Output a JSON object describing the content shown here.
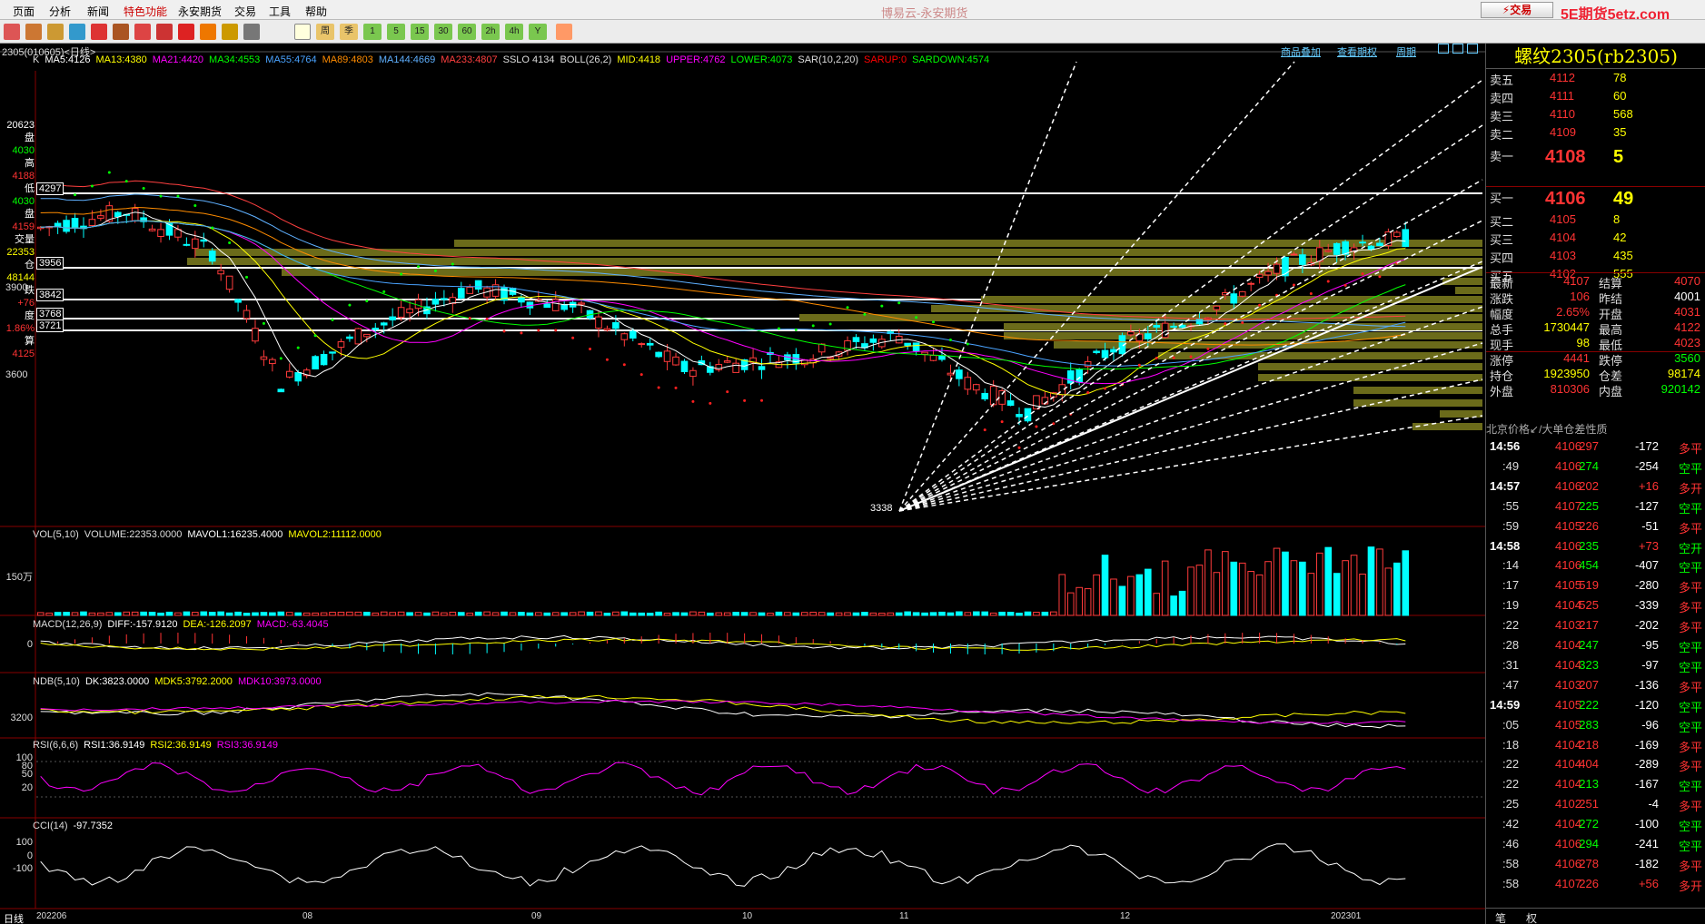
{
  "menu": [
    "页面",
    "分析",
    "新闻",
    "特色功能",
    "永安期货",
    "交易",
    "工具",
    "帮助"
  ],
  "app_title": "博易云-永安期货",
  "trade_button": "交易",
  "watermark": "5E期货5etz.com",
  "toolbar_labels": [
    "周",
    "季",
    "1",
    "5",
    "15",
    "30",
    "60",
    "2h",
    "4h",
    "Y"
  ],
  "chart_header": {
    "symbol": "2305(010605)<日线>",
    "links": [
      "商品叠加",
      "查看期权",
      "周期"
    ]
  },
  "ma_line": [
    {
      "text": "K",
      "color": "#dddddd"
    },
    {
      "text": "MA5:4126",
      "color": "#ffffff"
    },
    {
      "text": "MA13:4380",
      "color": "#ffff00"
    },
    {
      "text": "MA21:4420",
      "color": "#ff00ff"
    },
    {
      "text": "MA34:4553",
      "color": "#00ff00"
    },
    {
      "text": "MA55:4764",
      "color": "#4aa3ff"
    },
    {
      "text": "MA89:4803",
      "color": "#ff8c00"
    },
    {
      "text": "MA144:4669",
      "color": "#5fb0ff"
    },
    {
      "text": "MA233:4807",
      "color": "#ff4040"
    },
    {
      "text": "SSLO 4134",
      "color": "#dddddd"
    },
    {
      "text": "BOLL(26,2)",
      "color": "#dddddd"
    },
    {
      "text": "MID:4418",
      "color": "#ffff00"
    },
    {
      "text": "UPPER:4762",
      "color": "#ff00ff"
    },
    {
      "text": "LOWER:4073",
      "color": "#00ff00"
    },
    {
      "text": "SAR(10,2,20)",
      "color": "#dddddd"
    },
    {
      "text": "SARUP:0",
      "color": "#ff0000"
    },
    {
      "text": "SARDOWN:4574",
      "color": "#00ff00"
    }
  ],
  "left_info": [
    {
      "text": "20623",
      "color": "#ffffff"
    },
    {
      "text": "盘",
      "color": "#ffffff"
    },
    {
      "text": "4030",
      "color": "#00ff00"
    },
    {
      "text": "高",
      "color": "#ffffff"
    },
    {
      "text": "4188",
      "color": "#ff3333"
    },
    {
      "text": "低",
      "color": "#ffffff"
    },
    {
      "text": "4030",
      "color": "#00ff00"
    },
    {
      "text": "盘",
      "color": "#ffffff"
    },
    {
      "text": "4159",
      "color": "#ff3333"
    },
    {
      "text": "交量",
      "color": "#ffffff"
    },
    {
      "text": "22353",
      "color": "#ffff00"
    },
    {
      "text": "仓",
      "color": "#ffffff"
    },
    {
      "text": "48144",
      "color": "#ffff00"
    },
    {
      "text": "跌",
      "color": "#ffffff"
    },
    {
      "text": "+76",
      "color": "#ff3333"
    },
    {
      "text": "度",
      "color": "#ffffff"
    },
    {
      "text": "1.86%",
      "color": "#ff3333"
    },
    {
      "text": "算",
      "color": "#ffffff"
    },
    {
      "text": "4125",
      "color": "#ff3333"
    }
  ],
  "price_levels": [
    {
      "label": "4297"
    },
    {
      "label": "3956"
    },
    {
      "label": "3842"
    },
    {
      "label": "3768"
    },
    {
      "label": "3721"
    }
  ],
  "y_axis_labels": [
    "3900",
    "3600"
  ],
  "low_marker": "3338",
  "volume_pane": {
    "title": "VOL(5,10)",
    "items": [
      {
        "text": "VOLUME:22353.0000",
        "color": "#dddddd"
      },
      {
        "text": "MAVOL1:16235.4000",
        "color": "#ffffff"
      },
      {
        "text": "MAVOL2:11112.0000",
        "color": "#ffff00"
      }
    ],
    "axis": "150万"
  },
  "macd_pane": {
    "title": "MACD(12,26,9)",
    "items": [
      {
        "text": "DIFF:-157.9120",
        "color": "#ffffff"
      },
      {
        "text": "DEA:-126.2097",
        "color": "#ffff00"
      },
      {
        "text": "MACD:-63.4045",
        "color": "#ff00ff"
      }
    ],
    "axis": "0"
  },
  "ndb_pane": {
    "title": "NDB(5,10)",
    "items": [
      {
        "text": "DK:3823.0000",
        "color": "#ffffff"
      },
      {
        "text": "MDK5:3792.2000",
        "color": "#ffff00"
      },
      {
        "text": "MDK10:3973.0000",
        "color": "#ff00ff"
      }
    ],
    "axis": "3200"
  },
  "rsi_pane": {
    "title": "RSI(6,6,6)",
    "items": [
      {
        "text": "RSI1:36.9149",
        "color": "#ffffff"
      },
      {
        "text": "RSI2:36.9149",
        "color": "#ffff00"
      },
      {
        "text": "RSI3:36.9149",
        "color": "#ff00ff"
      }
    ],
    "axis": [
      "100",
      "50",
      "20"
    ],
    "axis_top": "80"
  },
  "cci_pane": {
    "title": "CCI(14)",
    "items": [
      {
        "text": "-97.7352",
        "color": "#ffffff"
      }
    ],
    "axis": [
      "100",
      "0",
      "-100"
    ]
  },
  "x_axis": {
    "period_label": "日线",
    "labels": [
      "202206",
      "08",
      "09",
      "10",
      "11",
      "12",
      "202301"
    ]
  },
  "right_panel": {
    "title": "螺纹2305(rb2305)",
    "asks": [
      {
        "label": "卖五",
        "price": "4112",
        "qty": "78"
      },
      {
        "label": "卖四",
        "price": "4111",
        "qty": "60"
      },
      {
        "label": "卖三",
        "price": "4110",
        "qty": "568"
      },
      {
        "label": "卖二",
        "price": "4109",
        "qty": "35"
      },
      {
        "label": "卖一",
        "price": "4108",
        "qty": "5"
      }
    ],
    "bids": [
      {
        "label": "买一",
        "price": "4106",
        "qty": "49"
      },
      {
        "label": "买二",
        "price": "4105",
        "qty": "8"
      },
      {
        "label": "买三",
        "price": "4104",
        "qty": "42"
      },
      {
        "label": "买四",
        "price": "4103",
        "qty": "435"
      },
      {
        "label": "买五",
        "price": "4102",
        "qty": "555"
      }
    ],
    "stats": [
      {
        "l1": "最新",
        "v1": "4107",
        "c1": "#ff3333",
        "l2": "结算",
        "v2": "4070",
        "c2": "#ff3333"
      },
      {
        "l1": "涨跌",
        "v1": "106",
        "c1": "#ff3333",
        "l2": "昨结",
        "v2": "4001",
        "c2": "#ffffff"
      },
      {
        "l1": "幅度",
        "v1": "2.65%",
        "c1": "#ff3333",
        "l2": "开盘",
        "v2": "4031",
        "c2": "#ff3333"
      },
      {
        "l1": "总手",
        "v1": "1730447",
        "c1": "#ffff00",
        "l2": "最高",
        "v2": "4122",
        "c2": "#ff3333"
      },
      {
        "l1": "现手",
        "v1": "98",
        "c1": "#ffff00",
        "l2": "最低",
        "v2": "4023",
        "c2": "#ff3333"
      },
      {
        "l1": "涨停",
        "v1": "4441",
        "c1": "#ff3333",
        "l2": "跌停",
        "v2": "3560",
        "c2": "#00ff00"
      },
      {
        "l1": "持仓",
        "v1": "1923950",
        "c1": "#ffff00",
        "l2": "仓差",
        "v2": "98174",
        "c2": "#ffff00"
      },
      {
        "l1": "外盘",
        "v1": "810306",
        "c1": "#ff3333",
        "l2": "内盘",
        "v2": "920142",
        "c2": "#00ff00"
      }
    ],
    "tick_header": {
      "time": "北京",
      "price": "价格",
      "vol": "↙/大单",
      "oi": "仓差",
      "type": "性质"
    },
    "ticks": [
      {
        "time": "14:56",
        "price": "4106",
        "vol": "297",
        "oi": "-172",
        "type": "多平",
        "major": true
      },
      {
        "time": ":49",
        "price": "4106",
        "vol": "274",
        "oi": "-254",
        "type": "空平",
        "major": false
      },
      {
        "time": "14:57",
        "price": "4106",
        "vol": "202",
        "oi": "+16",
        "type": "多开",
        "major": true
      },
      {
        "time": ":55",
        "price": "4107",
        "vol": "225",
        "oi": "-127",
        "type": "空平",
        "major": false
      },
      {
        "time": ":59",
        "price": "4105",
        "vol": "226",
        "oi": "-51",
        "type": "多平",
        "major": false
      },
      {
        "time": "14:58",
        "price": "4106",
        "vol": "235",
        "oi": "+73",
        "type": "空开",
        "major": true
      },
      {
        "time": ":14",
        "price": "4106",
        "vol": "454",
        "oi": "-407",
        "type": "空平",
        "major": false
      },
      {
        "time": ":17",
        "price": "4105",
        "vol": "519",
        "oi": "-280",
        "type": "多平",
        "major": false
      },
      {
        "time": ":19",
        "price": "4104",
        "vol": "525",
        "oi": "-339",
        "type": "多平",
        "major": false
      },
      {
        "time": ":22",
        "price": "4103",
        "vol": "217",
        "oi": "-202",
        "type": "多平",
        "major": false
      },
      {
        "time": ":28",
        "price": "4104",
        "vol": "247",
        "oi": "-95",
        "type": "空平",
        "major": false
      },
      {
        "time": ":31",
        "price": "4104",
        "vol": "323",
        "oi": "-97",
        "type": "空平",
        "major": false
      },
      {
        "time": ":47",
        "price": "4103",
        "vol": "207",
        "oi": "-136",
        "type": "多平",
        "major": false
      },
      {
        "time": "14:59",
        "price": "4105",
        "vol": "222",
        "oi": "-120",
        "type": "空平",
        "major": true
      },
      {
        "time": ":05",
        "price": "4105",
        "vol": "283",
        "oi": "-96",
        "type": "空平",
        "major": false
      },
      {
        "time": ":18",
        "price": "4104",
        "vol": "218",
        "oi": "-169",
        "type": "多平",
        "major": false
      },
      {
        "time": ":22",
        "price": "4104",
        "vol": "404",
        "oi": "-289",
        "type": "多平",
        "major": false
      },
      {
        "time": ":22",
        "price": "4104",
        "vol": "213",
        "oi": "-167",
        "type": "空平",
        "major": false
      },
      {
        "time": ":25",
        "price": "4102",
        "vol": "251",
        "oi": "-4",
        "type": "多平",
        "major": false
      },
      {
        "time": ":42",
        "price": "4104",
        "vol": "272",
        "oi": "-100",
        "type": "空平",
        "major": false
      },
      {
        "time": ":46",
        "price": "4106",
        "vol": "294",
        "oi": "-241",
        "type": "空平",
        "major": false
      },
      {
        "time": ":58",
        "price": "4106",
        "vol": "278",
        "oi": "-182",
        "type": "多平",
        "major": false
      },
      {
        "time": ":58",
        "price": "4107",
        "vol": "226",
        "oi": "+56",
        "type": "多开",
        "major": false
      }
    ],
    "bottom_tabs": [
      "笔",
      "权"
    ]
  }
}
